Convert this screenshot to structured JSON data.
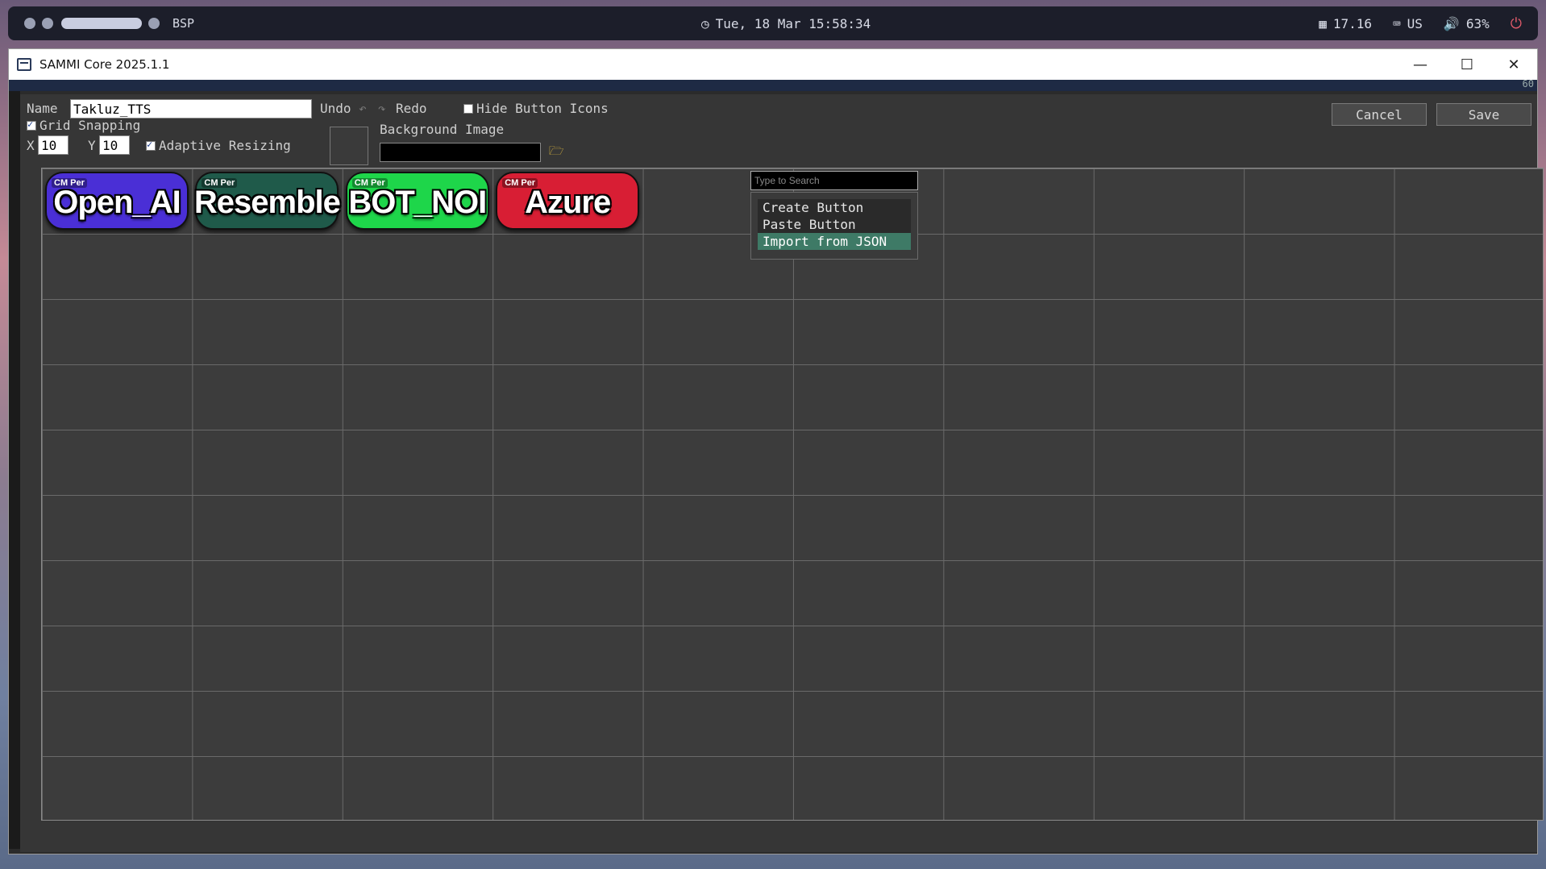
{
  "topbar": {
    "layout": "BSP",
    "clock": "Tue, 18 Mar 15:58:34",
    "memory": "17.16",
    "keyboard": "US",
    "volume": "63%"
  },
  "window": {
    "title": "SAMMI Core 2025.1.1",
    "strip_number": "60"
  },
  "editor": {
    "name_label": "Name",
    "name_value": "Takluz_TTS",
    "undo_label": "Undo",
    "redo_label": "Redo",
    "hide_icons_label": "Hide Button Icons",
    "hide_icons_checked": false,
    "grid_snapping_label": "Grid Snapping",
    "grid_snapping_checked": true,
    "x_label": "X",
    "x_value": "10",
    "y_label": "Y",
    "y_value": "10",
    "adaptive_label": "Adaptive Resizing",
    "adaptive_checked": true,
    "background_label": "Background Image",
    "cancel_label": "Cancel",
    "save_label": "Save"
  },
  "deck_buttons": [
    {
      "label": "Open_AI",
      "badge": "CM Per",
      "color": "#4a2fd6"
    },
    {
      "label": "Resemble",
      "badge": "CM Per",
      "color": "#1f5a4a"
    },
    {
      "label": "BOT_NOI",
      "badge": "CM Per",
      "color": "#1ed64a"
    },
    {
      "label": "Azure",
      "badge": "CM Per",
      "color": "#d81e34"
    }
  ],
  "context_menu": {
    "search_placeholder": "Type to Search",
    "items": [
      "Create Button",
      "Paste Button",
      "Import from JSON"
    ],
    "highlighted_index": 2
  },
  "colors": {
    "accent_highlight": "#3e7a66",
    "editor_bg": "#363636"
  }
}
